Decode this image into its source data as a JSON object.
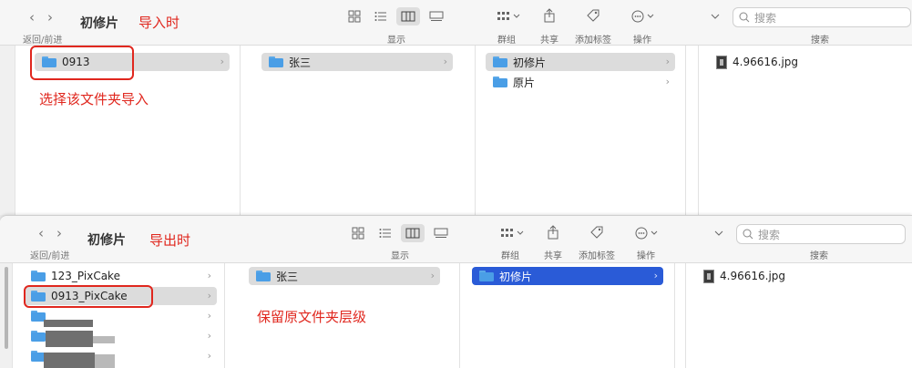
{
  "top": {
    "window_title": "初修片",
    "annotation_title": "导入时",
    "nav_label": "返回/前进",
    "view_label": "显示",
    "group_label": "群组",
    "share_label": "共享",
    "tag_label": "添加标签",
    "action_label": "操作",
    "search_placeholder": "搜索",
    "search_label": "搜索",
    "col1": [
      {
        "name": "0913"
      }
    ],
    "col1_note": "选择该文件夹导入",
    "col2": [
      {
        "name": "张三"
      }
    ],
    "col3": [
      {
        "name": "初修片"
      },
      {
        "name": "原片"
      }
    ],
    "col4": [
      {
        "name": "4.96616.jpg"
      }
    ]
  },
  "bottom": {
    "window_title": "初修片",
    "annotation_title": "导出时",
    "nav_label": "返回/前进",
    "view_label": "显示",
    "group_label": "群组",
    "share_label": "共享",
    "tag_label": "添加标签",
    "action_label": "操作",
    "search_placeholder": "搜索",
    "search_label": "搜索",
    "col1": [
      {
        "name": "123_PixCake"
      },
      {
        "name": "0913_PixCake"
      }
    ],
    "col2": [
      {
        "name": "张三"
      }
    ],
    "col2_note": "保留原文件夹层级",
    "col3": [
      {
        "name": "初修片"
      }
    ],
    "col4": [
      {
        "name": "4.96616.jpg"
      }
    ]
  },
  "icons": {
    "back": "chevron-left-icon",
    "forward": "chevron-right-icon",
    "folder": "folder-icon",
    "image_file": "jpg-file-icon",
    "search": "magnifier-icon"
  },
  "colors": {
    "annotation_red": "#e0271e",
    "selection_blue": "#2a5bd7",
    "folder_blue": "#4a9ee6"
  }
}
